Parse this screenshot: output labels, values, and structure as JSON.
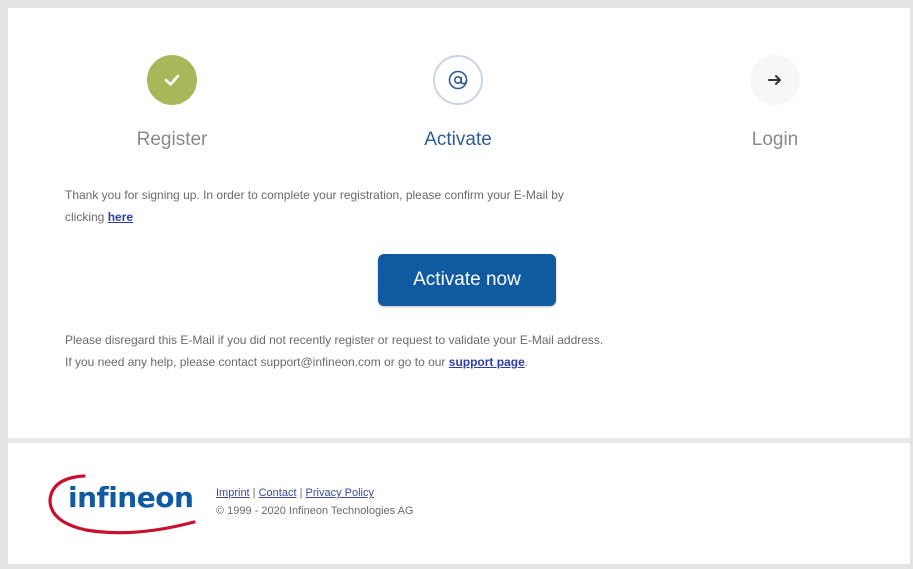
{
  "steps": [
    {
      "label": "Register",
      "icon": "check-icon",
      "state": "done"
    },
    {
      "label": "Activate",
      "icon": "at-sign-icon",
      "state": "active"
    },
    {
      "label": "Login",
      "icon": "arrow-right-icon",
      "state": "next"
    }
  ],
  "message": {
    "line1": "Thank you for signing up. In order to complete your registration, please confirm your E-Mail by",
    "clicking": "clicking ",
    "here_link": "here"
  },
  "activate_button": "Activate now",
  "disclaimer": {
    "line1": "Please disregard this E-Mail if you did not recently register or request to validate your E-Mail address.",
    "line2": "If you need any help, please contact support@infineon.com or go to our ",
    "support_link": "support page",
    "end": "."
  },
  "footer": {
    "logo_text": "infineon",
    "imprint": "Imprint",
    "contact": "Contact",
    "privacy": "Privacy Policy",
    "separator": " | ",
    "copyright": "© 1999 - 2020 Infineon Technologies AG"
  },
  "colors": {
    "brand_blue": "#0f5aa1",
    "brand_red": "#c8102e",
    "done_green": "#a6b95a"
  }
}
